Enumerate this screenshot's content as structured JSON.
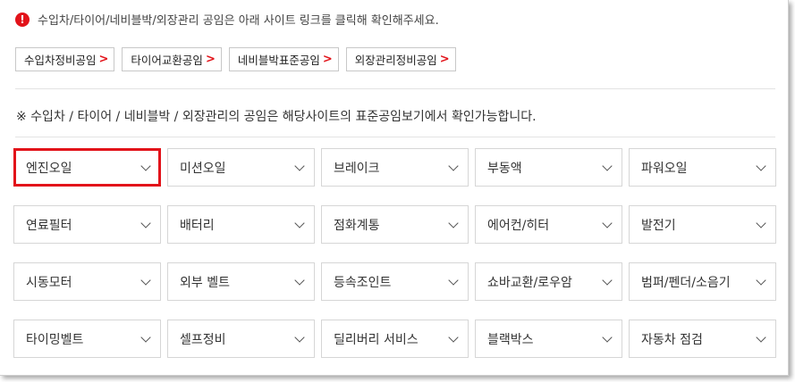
{
  "notice": {
    "icon": "alert-circle-icon",
    "icon_glyph": "!",
    "text": "수입차/타이어/네비블박/외장관리 공임은 아래 사이트 링크를 클릭해 확인해주세요."
  },
  "links": [
    {
      "label": "수입차정비공임"
    },
    {
      "label": "타이어교환공임"
    },
    {
      "label": "네비블박표준공임"
    },
    {
      "label": "외장관리정비공임"
    }
  ],
  "link_arrow": ">",
  "info_text": "※ 수입차 / 타이어 / 네비블박 / 외장관리의 공임은 해당사이트의 표준공임보기에서 확인가능합니다.",
  "categories": [
    "엔진오일",
    "미션오일",
    "브레이크",
    "부동액",
    "파워오일",
    "연료필터",
    "배터리",
    "점화계통",
    "에어컨/히터",
    "발전기",
    "시동모터",
    "외부 벨트",
    "등속조인트",
    "쇼바교환/로우암",
    "범퍼/펜더/소음기",
    "타이밍벨트",
    "셀프정비",
    "딜리버리 서비스",
    "블랙박스",
    "자동차 점검"
  ],
  "selected_category_index": 0,
  "colors": {
    "accent": "#e2131a",
    "border": "#d6d6d6",
    "text": "#333333"
  }
}
